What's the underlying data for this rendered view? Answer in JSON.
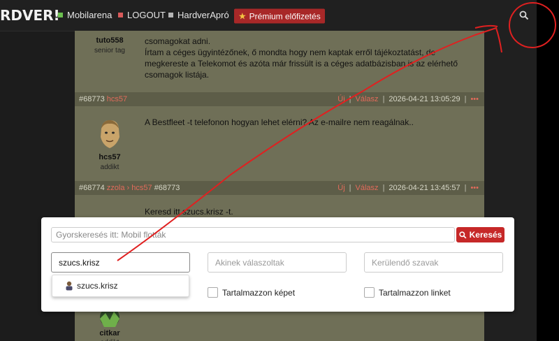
{
  "topbar": {
    "logo": "RDVER!",
    "nav": [
      {
        "label": "Mobilarena",
        "color": "green"
      },
      {
        "label": "LOGOUT",
        "color": "red"
      },
      {
        "label": "HardverApró",
        "color": "gray"
      }
    ],
    "premium": "Prémium előfizetés",
    "search_icon": "search-icon"
  },
  "posts": [
    {
      "username": "tuto558",
      "rank": "senior tag",
      "text_lines": [
        "csomagokat adni.",
        "Írtam a céges ügyintézőnek, ő mondta hogy nem kaptak erről tájékoztatást, de",
        "megkereste a Telekomot és azóta már frissült is a céges adatbázisban is az elérhető",
        "csomagok listája."
      ]
    },
    {
      "num": "#68773",
      "user": "hcs57",
      "new": "Új",
      "reply": "Válasz",
      "date": "2026-04-21 13:05:29",
      "more": "•••",
      "username": "hcs57",
      "rank": "addikt",
      "text": "A Bestfleet -t telefonon hogyan lehet elérni? Az e-mailre nem reagálnak.."
    },
    {
      "num": "#68774",
      "user": "zzola",
      "arrow": "›",
      "reply_to_user": "hcs57",
      "reply_to_num": "#68773",
      "new": "Új",
      "reply": "Válasz",
      "date": "2026-04-21 13:45:57",
      "more": "•••",
      "text": "Keresd itt szucs.krisz -t."
    },
    {
      "username": "citkar",
      "rank": "addikt"
    }
  ],
  "search": {
    "placeholder": "Gyorskeresés itt: Mobil flották",
    "button": "Keresés",
    "author_value": "szucs.krisz",
    "replied_placeholder": "Akinek válaszoltak",
    "exclude_placeholder": "Kerülendő szavak",
    "check_image": "Tartalmazzon képet",
    "check_link": "Tartalmazzon linket",
    "suggestion": "szucs.krisz"
  },
  "colors": {
    "accent": "#c62828",
    "link": "#e26b5b",
    "annotation": "#e02020"
  }
}
